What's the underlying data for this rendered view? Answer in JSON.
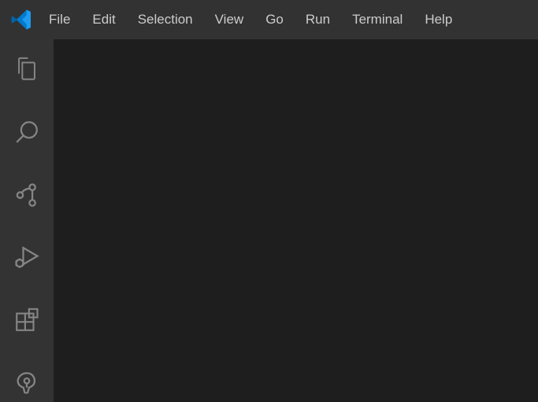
{
  "menu": {
    "file": "File",
    "edit": "Edit",
    "selection": "Selection",
    "view": "View",
    "go": "Go",
    "run": "Run",
    "terminal": "Terminal",
    "help": "Help"
  },
  "activitybar": {
    "explorer": "explorer-icon",
    "search": "search-icon",
    "source_control": "source-control-icon",
    "run_debug": "run-debug-icon",
    "extensions": "extensions-icon",
    "gitlens": "gitlens-icon"
  }
}
